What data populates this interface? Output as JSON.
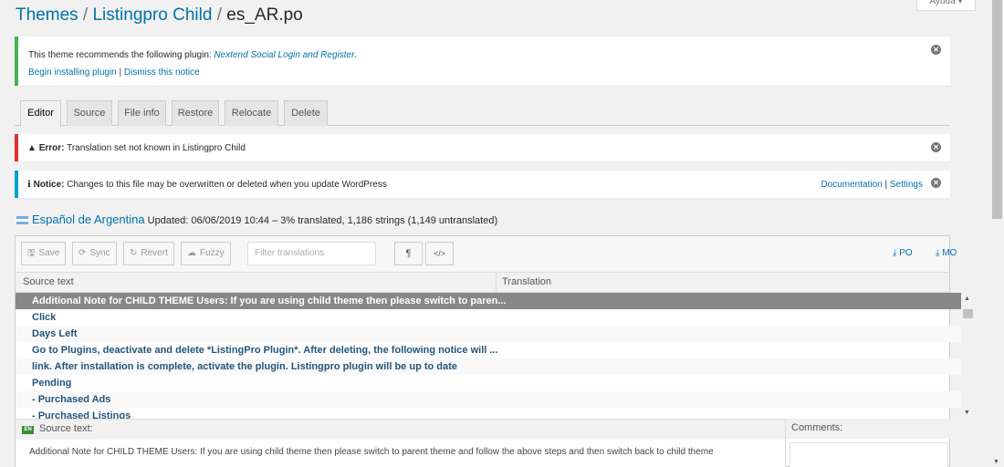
{
  "help_tab": "Ayuda ▾",
  "breadcrumb": {
    "themes": "Themes",
    "sep1": " / ",
    "child": "Listingpro Child",
    "sep2": " / ",
    "file": "es_AR.po"
  },
  "plugin_notice": {
    "text": "This theme recommends the following plugin: ",
    "plugin": "Nextend Social Login and Register",
    "period": ".",
    "install": "Begin installing plugin",
    "sep": " | ",
    "dismiss": "Dismiss this notice"
  },
  "tabs": [
    {
      "label": "Editor"
    },
    {
      "label": "Source"
    },
    {
      "label": "File info"
    },
    {
      "label": "Restore"
    },
    {
      "label": "Relocate"
    },
    {
      "label": "Delete"
    }
  ],
  "error_notice": {
    "label": "Error:",
    "text": " Translation set not known in Listingpro Child"
  },
  "info_notice": {
    "label": "Notice:",
    "text": " Changes to this file may be overwritten or deleted when you update WordPress",
    "documentation": "Documentation",
    "sep": " | ",
    "settings": "Settings"
  },
  "language": {
    "name": "Español de Argentina",
    "meta": "Updated: 06/06/2019 10:44 – 3% translated, 1,186 strings (1,149 untranslated)"
  },
  "toolbar": {
    "save": "Save",
    "sync": "Sync",
    "revert": "Revert",
    "fuzzy": "Fuzzy",
    "filter_placeholder": "Filter translations",
    "pilcrow": "¶",
    "code": "</>",
    "po": "PO",
    "mo": "MO"
  },
  "columns": {
    "source": "Source text",
    "translation": "Translation"
  },
  "rows": [
    "Additional Note for CHILD THEME Users: If you are using child theme then please switch to paren...",
    "Click",
    "Days Left",
    "Go to Plugins, deactivate and delete *ListingPro Plugin*. After deleting, the following notice will ...",
    "link. After installation is complete, activate the plugin. Listingpro plugin will be up to date",
    "Pending",
    "- Purchased Ads",
    "- Purchased Listings"
  ],
  "source_panel": {
    "badge": "EN",
    "label": "Source text:",
    "text": "Additional Note for CHILD THEME Users: If you are using child theme then please switch to parent theme and follow the above steps and then switch back to child theme"
  },
  "comments_panel": {
    "label": "Comments:"
  },
  "colors": {
    "accent": "#0073aa",
    "success": "#46b450",
    "error": "#dc3232",
    "info": "#00a0d2",
    "selected_row": "#888888"
  }
}
